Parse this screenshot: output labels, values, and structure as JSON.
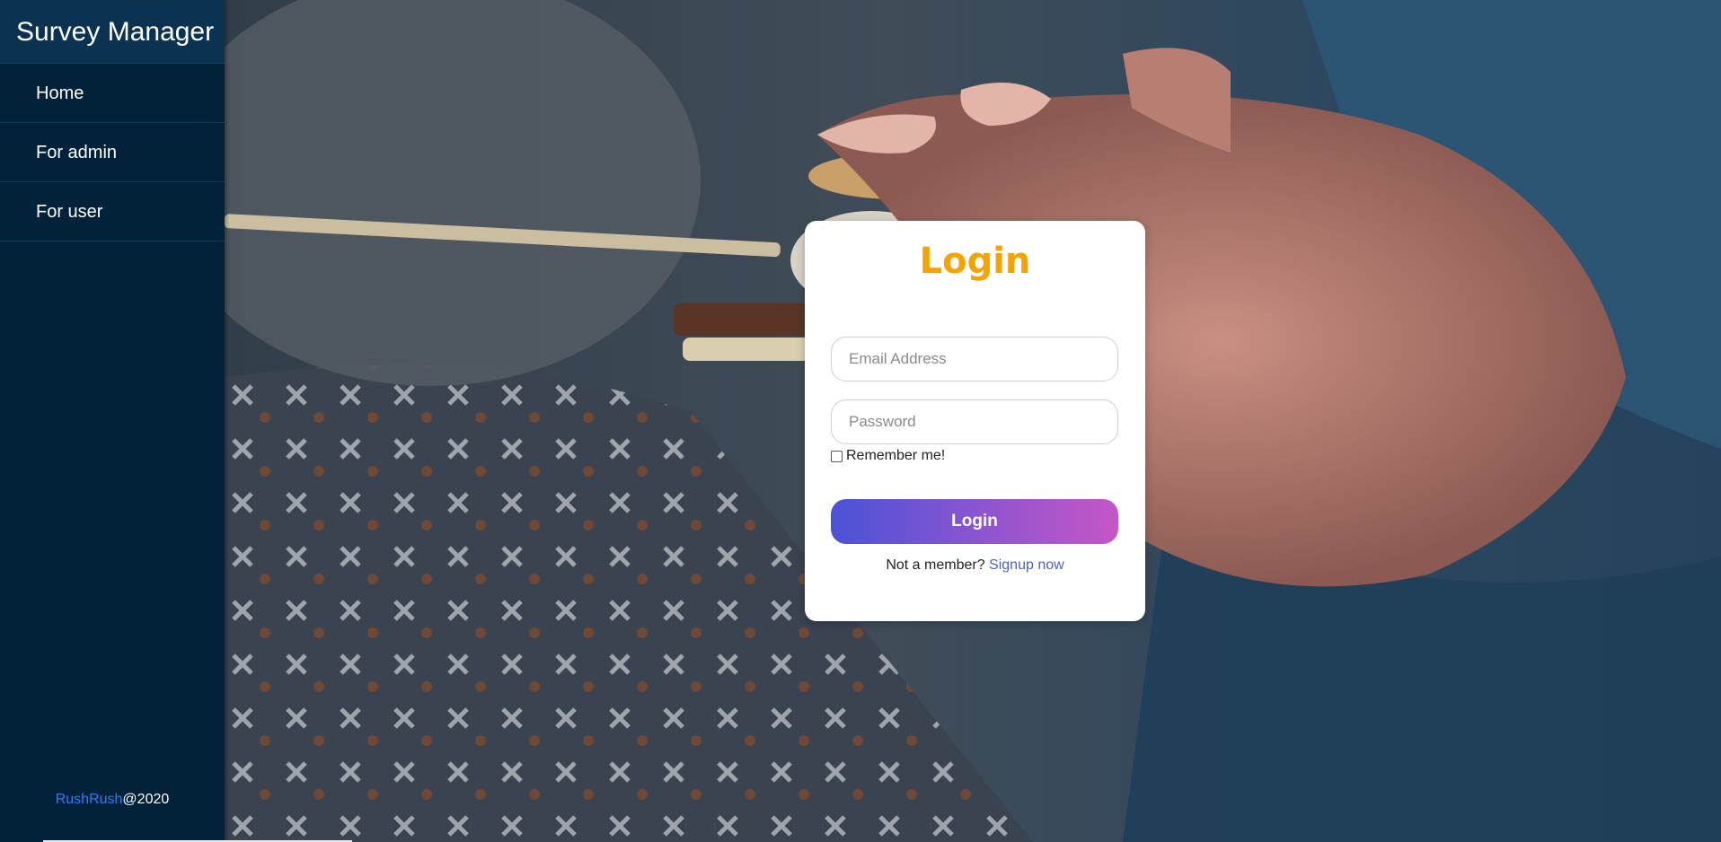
{
  "brand": {
    "title": "Survey Manager"
  },
  "nav": {
    "items": [
      {
        "label": "Home"
      },
      {
        "label": "For admin"
      },
      {
        "label": "For user"
      }
    ]
  },
  "footer": {
    "link_text": "RushRush",
    "suffix": "@2020"
  },
  "background": {
    "description_icon": "photo-background"
  },
  "login": {
    "title": "Login",
    "email_placeholder": "Email Address",
    "password_placeholder": "Password",
    "remember_label": "Remember me!",
    "remember_checked": false,
    "button_label": "Login",
    "signup_prompt": "Not a member?",
    "signup_link": "Signup now"
  },
  "colors": {
    "sidebar": "#02223a",
    "brand_bar": "#0b3351",
    "title_accent": "#f5a300",
    "button_gradient_start": "#4a52d6",
    "button_gradient_end": "#c556c6",
    "link": "#4a63c7",
    "footer_link": "#2e7bff"
  }
}
